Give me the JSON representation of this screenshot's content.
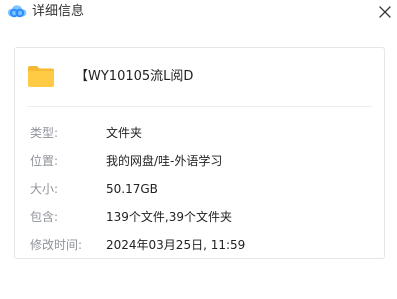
{
  "window": {
    "title": "详细信息",
    "logo_icon": "baidu-netdisk-logo-icon",
    "close_icon": "close-icon"
  },
  "file": {
    "icon": "folder-icon",
    "icon_color": "#FFCB45",
    "name": "【WY10105流L阅D"
  },
  "info": [
    {
      "label": "类型:",
      "value": "文件夹"
    },
    {
      "label": "位置:",
      "value": "我的网盘/哇-外语学习"
    },
    {
      "label": "大小:",
      "value": "50.17GB"
    },
    {
      "label": "包含:",
      "value": "139个文件,39个文件夹"
    },
    {
      "label": "修改时间:",
      "value": "2024年03月25日, 11:59"
    }
  ],
  "colors": {
    "logo_blue": "#2E8BFF",
    "logo_light_blue": "#7EC4FF",
    "label_gray": "#8F939A",
    "card_border": "#E4E6EA"
  }
}
